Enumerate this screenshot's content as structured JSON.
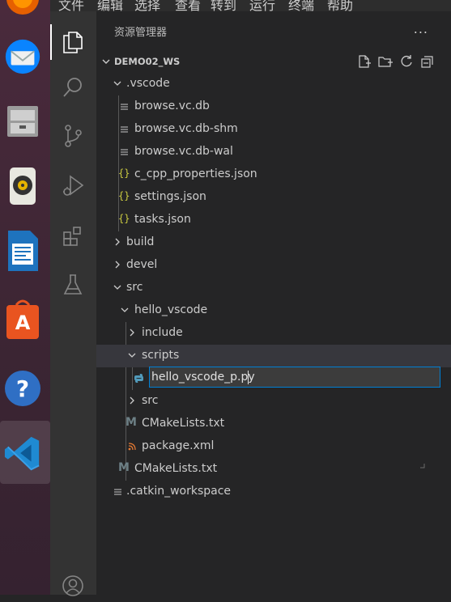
{
  "menubar": {
    "items": [
      "文件",
      "编辑",
      "选择",
      "查看",
      "转到",
      "运行",
      "终端",
      "帮助"
    ]
  },
  "dock": {
    "apps": [
      "firefox",
      "thunderbird",
      "file-cabinet",
      "rhythmbox",
      "libreoffice-writer",
      "ubuntu-software",
      "help",
      "vscode"
    ],
    "active": "vscode"
  },
  "activity_bar": {
    "icons": [
      "explorer-icon",
      "search-icon",
      "source-control-icon",
      "run-debug-icon",
      "extensions-icon",
      "testing-icon",
      "account-icon"
    ],
    "active": "explorer-icon"
  },
  "sidebar": {
    "title": "资源管理器",
    "more": "...",
    "workspace": "DEMO02_WS"
  },
  "tree": [
    {
      "label": ".vscode",
      "type": "folder",
      "expanded": true,
      "depth": 1
    },
    {
      "label": "browse.vc.db",
      "type": "lines",
      "depth": 2
    },
    {
      "label": "browse.vc.db-shm",
      "type": "lines",
      "depth": 2
    },
    {
      "label": "browse.vc.db-wal",
      "type": "lines",
      "depth": 2
    },
    {
      "label": "c_cpp_properties.json",
      "type": "json",
      "depth": 2
    },
    {
      "label": "settings.json",
      "type": "json",
      "depth": 2
    },
    {
      "label": "tasks.json",
      "type": "json",
      "depth": 2
    },
    {
      "label": "build",
      "type": "folder",
      "expanded": false,
      "depth": 1
    },
    {
      "label": "devel",
      "type": "folder",
      "expanded": false,
      "depth": 1
    },
    {
      "label": "src",
      "type": "folder",
      "expanded": true,
      "depth": 1
    },
    {
      "label": "hello_vscode",
      "type": "folder",
      "expanded": true,
      "depth": 2
    },
    {
      "label": "include",
      "type": "folder",
      "expanded": false,
      "depth": 3
    },
    {
      "label": "scripts",
      "type": "folder",
      "expanded": true,
      "depth": 3,
      "selected": true
    },
    {
      "label": "",
      "type": "python",
      "depth": 4,
      "renaming": true
    },
    {
      "label": "src",
      "type": "folder",
      "expanded": false,
      "depth": 3
    },
    {
      "label": "CMakeLists.txt",
      "type": "cmake",
      "depth": 3
    },
    {
      "label": "package.xml",
      "type": "rss",
      "depth": 3
    },
    {
      "label": "CMakeLists.txt",
      "type": "cmake",
      "depth": 2
    },
    {
      "label": ".catkin_workspace",
      "type": "lines",
      "depth": 1
    }
  ],
  "rename_input": {
    "value": "hello_vscode_p.py"
  },
  "colors": {
    "json_icon": "#cbcb41",
    "cmake_icon": "#6d8086",
    "python_icon": "#519aba",
    "rss_icon": "#e37933",
    "focus_border": "#007fd4",
    "selected_row": "#37373d"
  }
}
